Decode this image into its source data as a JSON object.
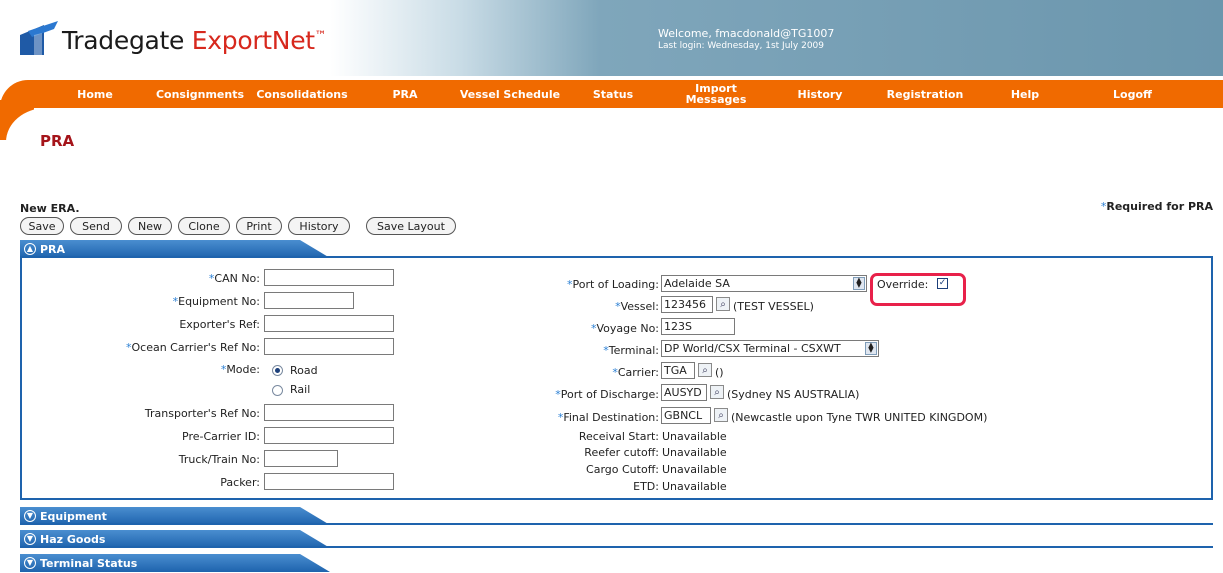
{
  "header": {
    "brand_part1": "Tradegate ",
    "brand_part2": "ExportNet",
    "brand_tm": "™",
    "welcome": "Welcome, fmacdonald@TG1007",
    "last_login": "Last login: Wednesday, 1st July 2009"
  },
  "nav": [
    "Home",
    "Consignments",
    "Consolidations",
    "PRA",
    "Vessel Schedule",
    "Status",
    "Import Messages",
    "History",
    "Registration",
    "Help",
    "Logoff"
  ],
  "page_title": "PRA",
  "status_message": "New ERA.",
  "required_note": "Required for PRA",
  "buttons": [
    "Save",
    "Send",
    "New",
    "Clone",
    "Print",
    "History",
    "Save Layout"
  ],
  "sections": {
    "pra": "PRA",
    "equipment": "Equipment",
    "haz_goods": "Haz Goods",
    "terminal_status": "Terminal Status"
  },
  "form_left": {
    "can_no": "CAN No:",
    "equipment_no": "Equipment No:",
    "exporters_ref": "Exporter's Ref:",
    "ocean_carrier_ref": "Ocean Carrier's Ref No:",
    "mode": "Mode:",
    "mode_road": "Road",
    "mode_rail": "Rail",
    "transporter_ref": "Transporter's Ref No:",
    "pre_carrier_id": "Pre-Carrier ID:",
    "truck_train_no": "Truck/Train No:",
    "packer": "Packer:"
  },
  "form_right": {
    "port_of_loading_label": "Port of Loading:",
    "port_of_loading_value": "Adelaide SA",
    "override_label": "Override:",
    "vessel_label": "Vessel:",
    "vessel_value": "123456",
    "vessel_desc": "(TEST VESSEL)",
    "voyage_label": "Voyage No:",
    "voyage_value": "123S",
    "terminal_label": "Terminal:",
    "terminal_value": "DP World/CSX Terminal - CSXWT",
    "carrier_label": "Carrier:",
    "carrier_value": "TGA",
    "carrier_desc": "()",
    "discharge_label": "Port of Discharge:",
    "discharge_value": "AUSYD",
    "discharge_desc": "(Sydney NS AUSTRALIA)",
    "final_dest_label": "Final Destination:",
    "final_dest_value": "GBNCL",
    "final_dest_desc": "(Newcastle upon Tyne TWR UNITED KINGDOM)",
    "receival_start": "Receival Start:",
    "reefer_cutoff": "Reefer cutoff:",
    "cargo_cutoff": "Cargo Cutoff:",
    "etd": "ETD:",
    "unavailable": "Unavailable"
  },
  "colors": {
    "nav_orange": "#f06a00",
    "section_blue": "#1e63ad",
    "title_red": "#a5141a",
    "highlight": "#e8214a"
  }
}
